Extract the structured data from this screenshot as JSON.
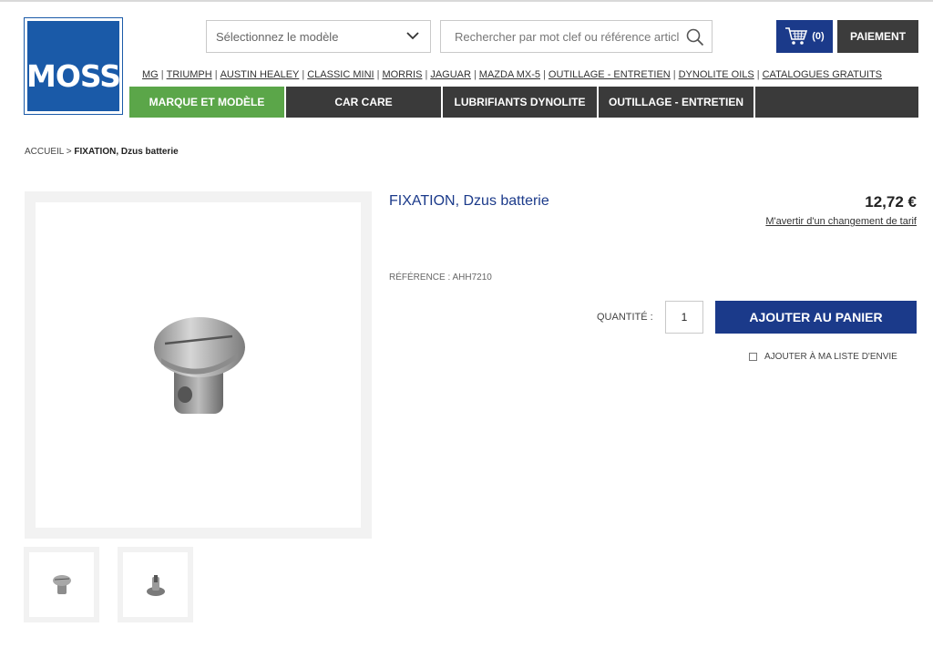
{
  "header": {
    "logo_text": "MOSS",
    "model_select": {
      "value": "Sélectionnez le modèle"
    },
    "search": {
      "placeholder": "Rechercher par mot clef ou référence article"
    },
    "cart": {
      "count": "(0)"
    },
    "checkout_label": "PAIEMENT",
    "brand_links": [
      "MG",
      "TRIUMPH",
      "AUSTIN HEALEY",
      "CLASSIC MINI",
      "MORRIS",
      "JAGUAR",
      "MAZDA MX-5",
      "OUTILLAGE - ENTRETIEN",
      "DYNOLITE OILS",
      "CATALOGUES GRATUITS"
    ],
    "nav": [
      {
        "label": "MARQUE ET MODÈLE",
        "active": true
      },
      {
        "label": "CAR CARE",
        "active": false
      },
      {
        "label": "LUBRIFIANTS DYNOLITE",
        "active": false
      },
      {
        "label": "OUTILLAGE - ENTRETIEN",
        "active": false
      }
    ]
  },
  "breadcrumb": {
    "home": "ACCUEIL",
    "sep": ">",
    "current": "FIXATION, Dzus batterie"
  },
  "product": {
    "title": "FIXATION, Dzus batterie",
    "price": "12,72 €",
    "price_alert": "M'avertir d'un changement de tarif",
    "reference": "RÉFÉRENCE : AHH7210",
    "quantity_label": "QUANTITÉ :",
    "quantity_value": "1",
    "add_to_cart": "AJOUTER AU PANIER",
    "wishlist": "AJOUTER À MA LISTE D'ENVIE"
  },
  "colors": {
    "brand_blue": "#1b3a8a",
    "logo_blue": "#1a5aa8",
    "nav_active_green": "#5ba649",
    "nav_dark": "#3a3a3a"
  }
}
